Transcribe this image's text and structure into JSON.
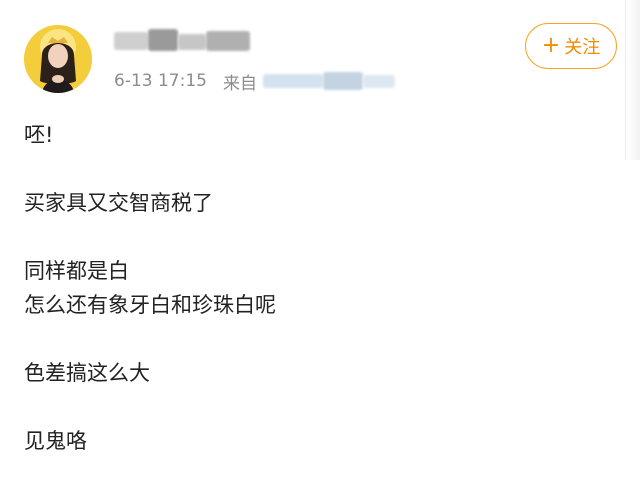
{
  "post_header": {
    "timestamp": "6-13 17:15",
    "from_label": "来自",
    "follow_label": "关注",
    "follow_plus": "+"
  },
  "colors": {
    "accent": "#f5a623",
    "meta_text": "#8c8c8c",
    "body_text": "#222222"
  },
  "post_body": {
    "lines": [
      "呸!",
      "买家具又交智商税了",
      "同样都是白",
      "怎么还有象牙白和珍珠白呢",
      "色差搞这么大",
      "见鬼咯"
    ]
  }
}
